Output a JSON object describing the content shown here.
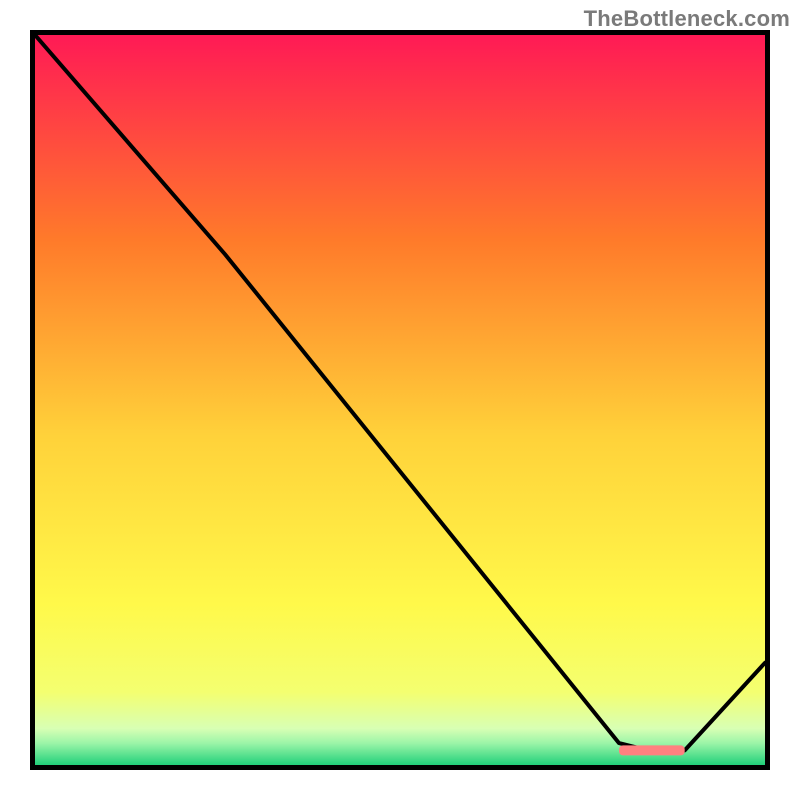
{
  "attribution": "TheBottleneck.com",
  "colors": {
    "frame": "#000000",
    "line": "#000000",
    "marker": "#ff8080",
    "gradient_top": "#ff1a55",
    "gradient_mid_upper": "#ff8a2a",
    "gradient_mid": "#ffe94a",
    "gradient_lower": "#f6ff6a",
    "gradient_band": "#d8ff9c",
    "gradient_bottom": "#21d07a"
  },
  "chart_data": {
    "type": "line",
    "title": "",
    "xlabel": "",
    "ylabel": "",
    "xlim": [
      0,
      100
    ],
    "ylim": [
      0,
      100
    ],
    "grid": false,
    "legend": false,
    "x": [
      0,
      26,
      80,
      84,
      89,
      100
    ],
    "values": [
      100,
      70,
      3,
      2,
      2,
      14
    ],
    "marker_segment": {
      "x_start": 80,
      "x_end": 89,
      "y": 2
    }
  }
}
